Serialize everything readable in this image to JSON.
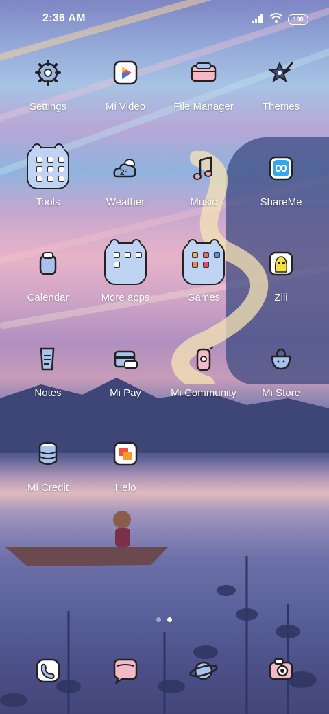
{
  "status_bar": {
    "time": "2:36 AM",
    "battery": "100",
    "icons": [
      "signal-icon",
      "wifi-icon",
      "battery-icon"
    ]
  },
  "apps": [
    {
      "name": "settings",
      "label": "Settings",
      "icon": "gear-icon"
    },
    {
      "name": "mi-video",
      "label": "Mi Video",
      "icon": "play-icon"
    },
    {
      "name": "file-manager",
      "label": "File Manager",
      "icon": "folder-icon"
    },
    {
      "name": "themes",
      "label": "Themes",
      "icon": "star-brush-icon"
    },
    {
      "name": "tools",
      "label": "Tools",
      "icon": "folder-group-icon"
    },
    {
      "name": "weather",
      "label": "Weather",
      "icon": "weather-icon"
    },
    {
      "name": "music",
      "label": "Music",
      "icon": "music-note-icon"
    },
    {
      "name": "shareme",
      "label": "ShareMe",
      "icon": "infinity-icon"
    },
    {
      "name": "calendar",
      "label": "Calendar",
      "icon": "calendar-icon"
    },
    {
      "name": "more-apps",
      "label": "More apps",
      "icon": "folder-group-icon"
    },
    {
      "name": "games",
      "label": "Games",
      "icon": "folder-group-icon"
    },
    {
      "name": "zili",
      "label": "Zili",
      "icon": "zili-icon"
    },
    {
      "name": "notes",
      "label": "Notes",
      "icon": "notes-icon"
    },
    {
      "name": "mi-pay",
      "label": "Mi Pay",
      "icon": "wallet-icon"
    },
    {
      "name": "mi-community",
      "label": "Mi Community",
      "icon": "community-icon"
    },
    {
      "name": "mi-store",
      "label": "Mi Store",
      "icon": "shopping-bag-icon"
    },
    {
      "name": "mi-credit",
      "label": "Mi Credit",
      "icon": "coins-icon"
    },
    {
      "name": "helo",
      "label": "Helo",
      "icon": "helo-icon"
    }
  ],
  "dock": [
    {
      "name": "phone",
      "icon": "phone-icon"
    },
    {
      "name": "messages",
      "icon": "chat-bubble-icon"
    },
    {
      "name": "browser",
      "icon": "planet-icon"
    },
    {
      "name": "camera",
      "icon": "camera-icon"
    }
  ],
  "page_indicator": {
    "pages": 2,
    "current": 2
  }
}
